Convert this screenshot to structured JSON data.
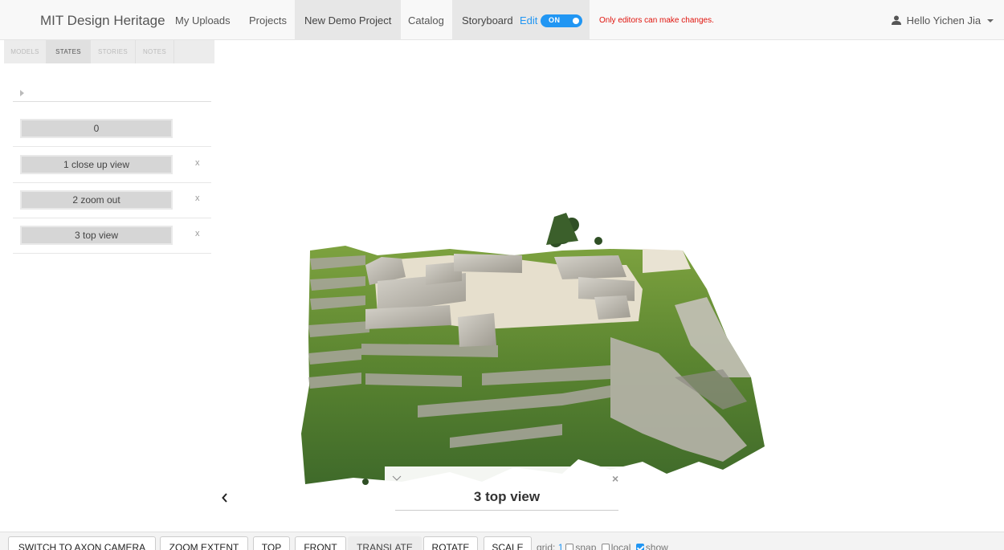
{
  "navbar": {
    "brand": "MIT Design Heritage",
    "items": [
      "My Uploads",
      "Projects",
      "New Demo Project",
      "Catalog",
      "Storyboard"
    ],
    "edit_label": "Edit",
    "toggle_text": "ON",
    "notice": "Only editors can make changes.",
    "user": "Hello Yichen Jia"
  },
  "sidebar": {
    "tabs": [
      "MODELS",
      "STATES",
      "STORIES",
      "NOTES"
    ],
    "active_tab": "STATES",
    "states": [
      {
        "label": "0",
        "removable": false
      },
      {
        "label": "1 close up view",
        "removable": true
      },
      {
        "label": "2 zoom out",
        "removable": true
      },
      {
        "label": "3 top view",
        "removable": true
      }
    ],
    "remove_symbol": "x"
  },
  "popup": {
    "title": "3 top view",
    "close_symbol": "×"
  },
  "toolbar": {
    "buttons": [
      "SWITCH TO AXON CAMERA",
      "ZOOM EXTENT",
      "TOP",
      "FRONT",
      "TRANSLATE",
      "ROTATE",
      "SCALE"
    ],
    "grid_label": "grid:",
    "grid_value": "1",
    "options": [
      {
        "label": "snap",
        "checked": false
      },
      {
        "label": "local",
        "checked": false
      },
      {
        "label": "show",
        "checked": true
      }
    ]
  },
  "colors": {
    "accent": "#2196f3",
    "notice": "#e0140d",
    "grass": "#5f8a2e",
    "stone": "#c8c5bd",
    "plaza": "#e6dfcd"
  },
  "icons": [
    "user-icon",
    "caret-down-icon",
    "play-arrow-icon",
    "chevron-left-icon",
    "chevron-down-icon",
    "close-icon"
  ]
}
